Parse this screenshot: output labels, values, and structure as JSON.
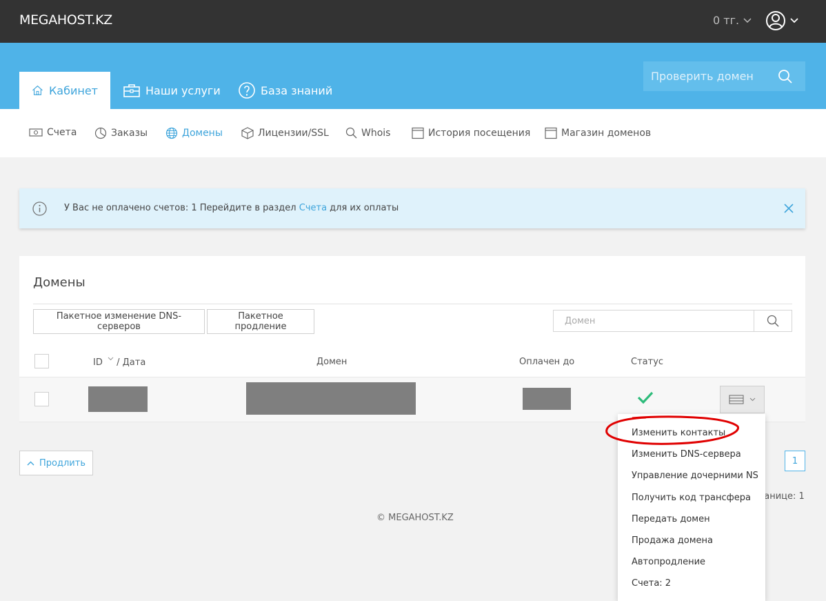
{
  "header": {
    "logo": "MEGAHOST.KZ",
    "balance": "0 тг."
  },
  "main_tabs": [
    {
      "label": "Кабинет"
    },
    {
      "label": "Наши услуги"
    },
    {
      "label": "База знаний"
    }
  ],
  "domain_check": {
    "placeholder": "Проверить домен"
  },
  "subnav": [
    {
      "label": "Счета"
    },
    {
      "label": "Заказы"
    },
    {
      "label": "Домены"
    },
    {
      "label": "Лицензии/SSL"
    },
    {
      "label": "Whois"
    },
    {
      "label": "История посещения"
    },
    {
      "label": "Магазин доменов"
    }
  ],
  "alert": {
    "text_before": "У Вас не оплачено счетов: 1 Перейдите в раздел ",
    "link": "Счета",
    "text_after": " для их оплаты"
  },
  "panel": {
    "title": "Домены",
    "batch_dns_button": "Пакетное изменение DNS-серверов",
    "batch_renew_button": "Пакетное продление",
    "search_placeholder": "Домен",
    "columns": {
      "id": "ID",
      "date": "/ Дата",
      "domain": "Домен",
      "paid_until": "Оплачен до",
      "status": "Статус"
    }
  },
  "footer_area": {
    "extend_button": "Продлить",
    "page_number": "1",
    "pages_text": "ранице: 1",
    "copyright": "© MEGAHOST.KZ"
  },
  "dropdown": [
    {
      "label": "Изменить контакты"
    },
    {
      "label": "Изменить DNS-сервера"
    },
    {
      "label": "Управление дочерними NS"
    },
    {
      "label": "Получить код трансфера"
    },
    {
      "label": "Передать домен"
    },
    {
      "label": "Продажа домена"
    },
    {
      "label": "Автопродление"
    },
    {
      "label": "Счета: 2"
    }
  ],
  "colors": {
    "topbar": "#333333",
    "accent_blue": "#4fb3e8",
    "link_blue": "#3da4db",
    "status_green": "#2dbb7a",
    "highlight_red": "#e00000"
  }
}
